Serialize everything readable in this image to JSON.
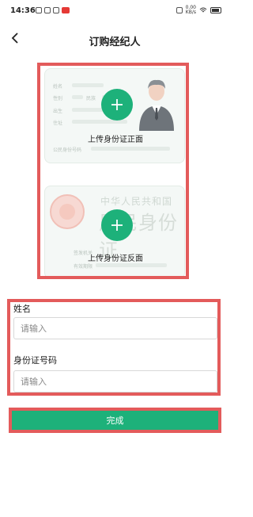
{
  "status_bar": {
    "time": "14:36",
    "net_speed_value": "0.00",
    "net_speed_unit": "KB/s",
    "battery": "69"
  },
  "header": {
    "title": "订购经纪人",
    "back_icon": "chevron-left-icon"
  },
  "id_front": {
    "caption": "上传身份证正面",
    "fields": {
      "name": "姓名",
      "gender": "性别",
      "ethnicity": "民族",
      "birth": "出生",
      "address": "住址",
      "id_number": "公民身份号码"
    }
  },
  "id_back": {
    "caption": "上传身份证反面",
    "country": "中华人民共和国",
    "card_title": "居民身份证",
    "fields": {
      "issuer": "签发机关",
      "validity": "有效期限"
    }
  },
  "form": {
    "name_label": "姓名",
    "name_placeholder": "请输入",
    "id_label": "身份证号码",
    "id_placeholder": "请输入"
  },
  "done_label": "完成",
  "colors": {
    "accent": "#1db17a",
    "highlight": "#e35b5b"
  }
}
